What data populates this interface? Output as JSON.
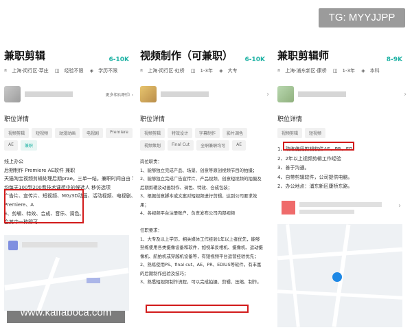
{
  "watermarks": {
    "top": "TG: MYYJJPP",
    "bottom": "www.kaifaboca.com"
  },
  "jobs": [
    {
      "title": "兼职剪辑",
      "salary": "6-10K",
      "meta": [
        "上海·闵行区·莘庄",
        "经验不限",
        "学历不限"
      ],
      "recruiter_link": "更多相似职位",
      "section_title": "职位详情",
      "tags": [
        "视频剪辑",
        "短视频",
        "动漫动画",
        "电视剧",
        "Premiere",
        "AE",
        "兼职"
      ],
      "desc": [
        "线上办公",
        "后期制作 Premiere AE软件 兼职",
        "天猫淘宝视频剪辑处理后期prae。三单一结。兼职时间自由 平",
        "均每天100到200看技术课想中的候选人 移仿选项",
        "广告片、宣传片、短视频、MG/3D动画、活动视频、电视剧、",
        "Premiere、A",
        "E、剪辑、特效、合成、音乐、调色。",
        "会其中一种即可"
      ]
    },
    {
      "title": "视频制作（可兼职）",
      "salary": "6-10K",
      "meta": [
        "上海·闵行区·虹桥",
        "1-3年",
        "大专"
      ],
      "section_title": "职位详情",
      "tags": [
        "视频剪辑",
        "特效设计",
        "字幕制作",
        "影片调色",
        "视频策划",
        "Final Cut",
        "全职兼职均可",
        "AE"
      ],
      "desc": [
        "岗位职责：",
        "1、能够独立完成产品、场景、创意等原创视频节目的拍摄；",
        "2、能够独立完成广告宣传片、产品视频、创意短视频的拍摄及",
        "后期剪辑及动画制作、调色、特效、合成包装；",
        "3、根据创意脚本或文案对短视频进行剪辑，达到公司要求效",
        "果；",
        "4、各视频平台注册账户，负责发布公司内部视频",
        "",
        "任职要求：",
        "1、大专及以上学历，相关媒体工作经验1年以上者优先，能够",
        "熟练使用各类摄像设备和软件，如视单反相机、摄像机、运动摄",
        "像机、航拍机或穿越机设备等，有短视频平台运营经验优先；",
        "2、熟练使用PS、final cut、AE、PR、EDIUS等软件，有丰富",
        "的后期制作经验及技巧；",
        "3、熟悉短视频制作流程，可以完成拍摄、剪辑、压缩、制作。"
      ]
    },
    {
      "title": "兼职剪辑师",
      "salary": "8-9K",
      "meta": [
        "上海·浦东新区·康桥",
        "1-3年",
        "本科"
      ],
      "section_title": "职位详情",
      "tags": [
        "视频剪辑",
        "短视频"
      ],
      "desc": [
        "1、熟练使用剪辑软件AE、PR、ED",
        "2、2年以上视频剪辑工作经验",
        "3、善于沟通。",
        "4、自带剪辑软件，公司提供电脑。",
        "2、办公地点：浦东新区康桥东路。"
      ]
    }
  ],
  "colors": {
    "accent": "#21b3a5",
    "highlight_box": "#d21a1a",
    "map_poi": "#7f8fe0"
  },
  "icons": {
    "location": "pin-icon",
    "experience": "briefcase-icon",
    "education": "graduation-cap-icon",
    "chevron": "chevron-right-icon"
  }
}
